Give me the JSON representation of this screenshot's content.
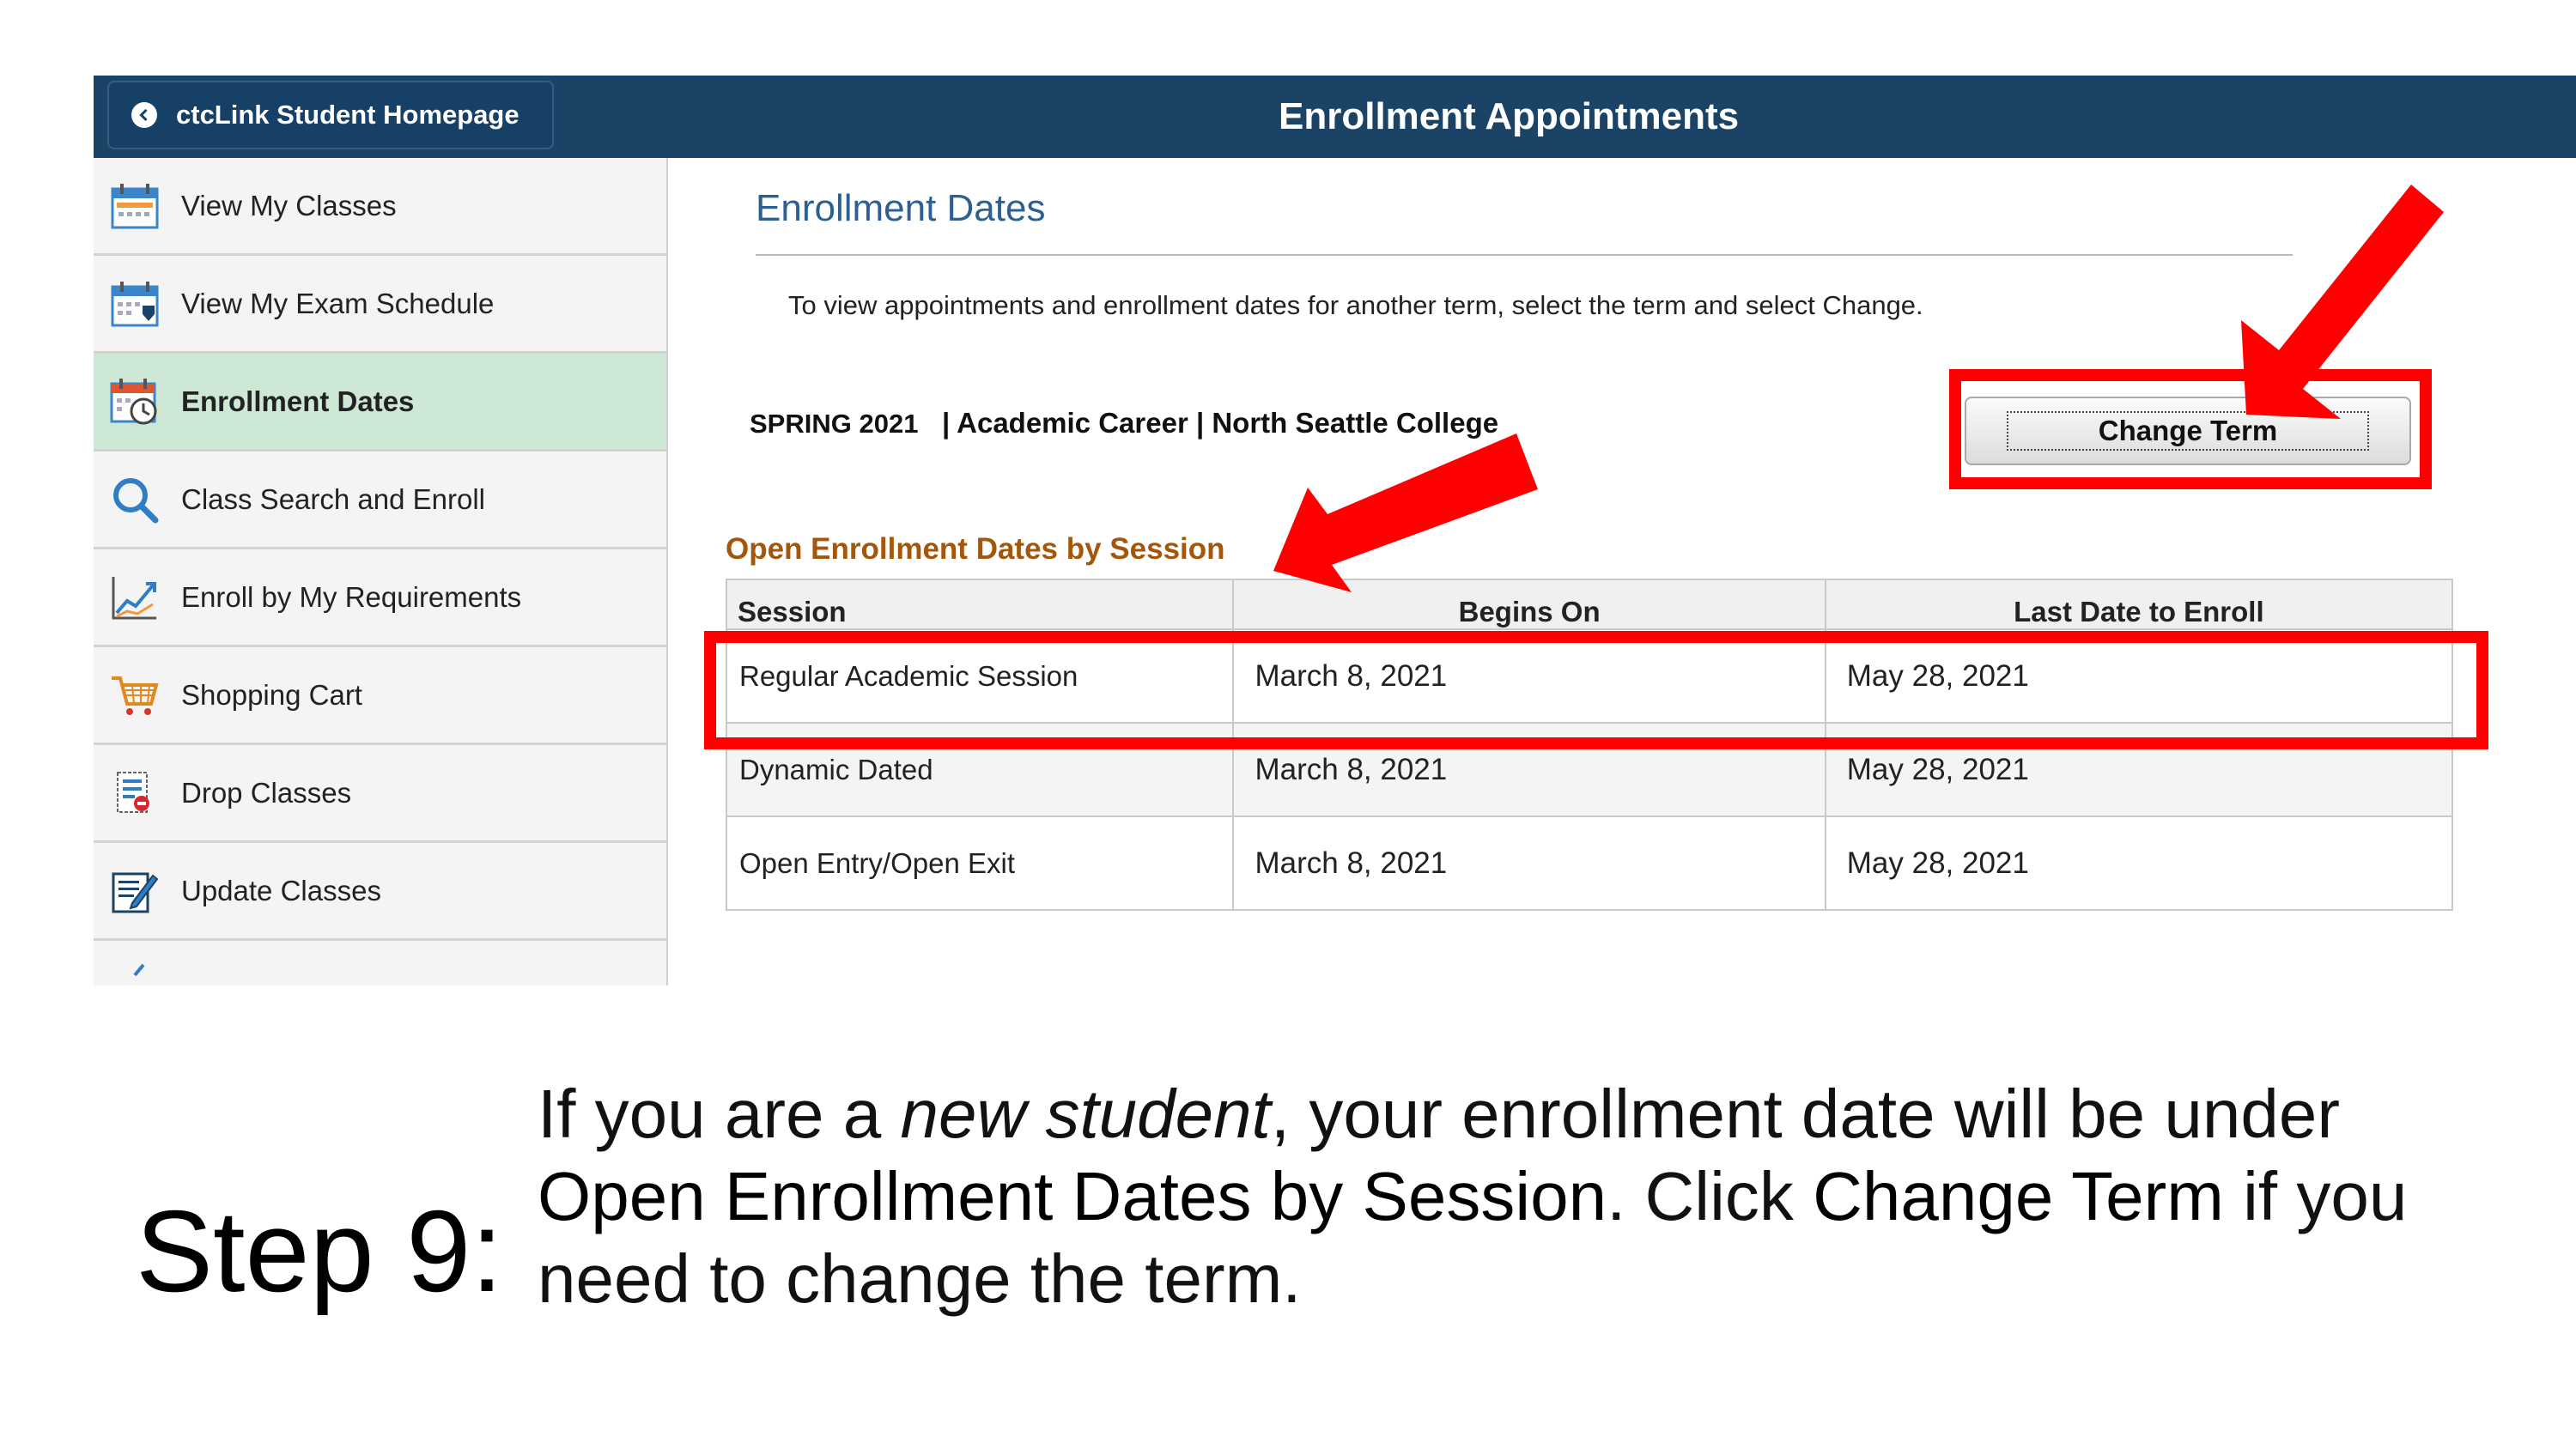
{
  "header": {
    "back_button_label": "ctcLink Student Homepage",
    "page_title": "Enrollment Appointments"
  },
  "sidebar": {
    "items": [
      {
        "label": "View My Classes",
        "icon": "calendar-icon"
      },
      {
        "label": "View My Exam Schedule",
        "icon": "exam-calendar-icon"
      },
      {
        "label": "Enrollment Dates",
        "icon": "enrollment-calendar-clock-icon",
        "active": true
      },
      {
        "label": "Class Search and Enroll",
        "icon": "search-icon"
      },
      {
        "label": "Enroll by My Requirements",
        "icon": "trend-chart-icon"
      },
      {
        "label": "Shopping Cart",
        "icon": "shopping-cart-icon"
      },
      {
        "label": "Drop Classes",
        "icon": "drop-list-icon"
      },
      {
        "label": "Update Classes",
        "icon": "edit-document-icon"
      }
    ]
  },
  "main": {
    "section_title": "Enrollment Dates",
    "instruction": "To view appointments and enrollment dates for another term, select the term and select Change.",
    "term": "SPRING 2021",
    "career_college": "| Academic Career | North Seattle College",
    "change_term_label": "Change Term",
    "table": {
      "caption": "Open Enrollment Dates by Session",
      "headers": [
        "Session",
        "Begins On",
        "Last Date to Enroll"
      ],
      "rows": [
        [
          "Regular Academic Session",
          "March 8, 2021",
          "May 28, 2021"
        ],
        [
          "Dynamic Dated",
          "March 8, 2021",
          "May 28, 2021"
        ],
        [
          "Open Entry/Open Exit",
          "March 8, 2021",
          "May 28, 2021"
        ]
      ]
    }
  },
  "instruction_slide": {
    "step_label": "Step 9:",
    "line1_prefix": "If you are a ",
    "line1_emph": "new student",
    "line1_suffix": ", your enrollment date will be under",
    "line2_term": "Open Enrollment Dates by Session",
    "line2_mid": ". Click ",
    "line2_button": "Change Term",
    "line2_suffix": " if you",
    "line3": "need to change the term."
  },
  "colors": {
    "header_bg": "#1b4366",
    "active_nav_bg": "#cde8d4",
    "section_title": "#2d5f93",
    "caption": "#a4570a",
    "highlight": "#ff0000"
  }
}
